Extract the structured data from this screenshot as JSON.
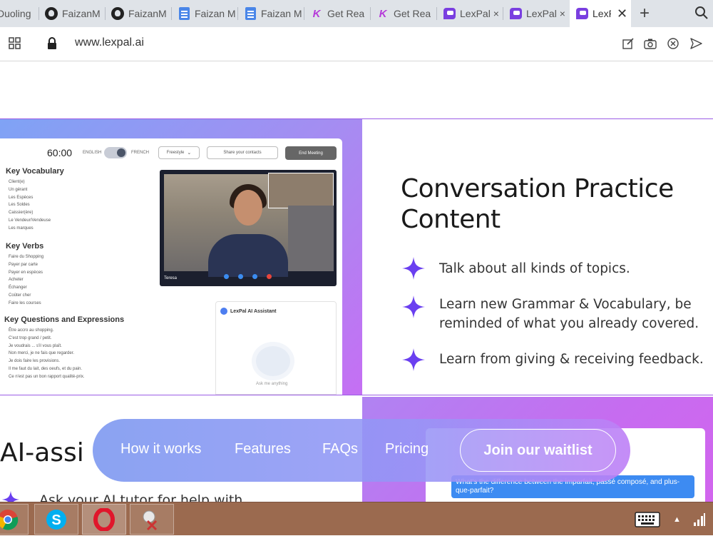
{
  "browser": {
    "tabs": [
      {
        "label": "Duoling",
        "icon": "duolingo-icon"
      },
      {
        "label": "FaizanM",
        "icon": "github-icon"
      },
      {
        "label": "FaizanM",
        "icon": "github-icon"
      },
      {
        "label": "Faizan M",
        "icon": "google-docs-icon"
      },
      {
        "label": "Faizan M",
        "icon": "google-docs-icon"
      },
      {
        "label": "Get Rea",
        "icon": "kotlin-icon"
      },
      {
        "label": "Get Rea",
        "icon": "kotlin-icon"
      },
      {
        "label": "LexPal ×",
        "icon": "lexpal-icon"
      },
      {
        "label": "LexPal ×",
        "icon": "lexpal-icon"
      },
      {
        "label": "LexP",
        "icon": "lexpal-icon",
        "active": true
      }
    ],
    "new_tab": "+",
    "url": "www.lexpal.ai"
  },
  "app_mock": {
    "timer": "60:00",
    "lang_left": "ENGLISH",
    "lang_right": "FRENCH",
    "mode_select": "Freestyle",
    "share_button": "Share your contacts",
    "end_button": "End Meeting",
    "vocab_heading": "Key Vocabulary",
    "vocab_items": [
      "Client(e)",
      "Un gérant",
      "Les Espèces",
      "Les Soldes",
      "Caissier(ère)",
      "Le Vendeur/Vendeuse",
      "Les marques"
    ],
    "verbs_heading": "Key Verbs",
    "verbs_items": [
      "Faire du Shopping",
      "Payer par carte",
      "Payer en espèces",
      "Acheter",
      "Échanger",
      "Coûter cher",
      "Faire les courses"
    ],
    "questions_heading": "Key Questions and Expressions",
    "questions_items": [
      "Être accro au shopping.",
      "C'est trop grand / petit.",
      "Je voudrais ... s'il vous plaît.",
      "Non merci, je ne fais que regarder.",
      "Je dois faire les provisions.",
      "Il me faut du lait, des oeufs, et du pain.",
      "Ce n'est pas un bon rapport qualité-prix."
    ],
    "video_name": "Teresa",
    "assistant_title": "LexPal AI Assistant",
    "assistant_hint": "Ask me anything"
  },
  "section": {
    "heading_line1": "Conversation Practice",
    "heading_line2": "Content",
    "features": [
      {
        "line1": "Talk about all kinds of topics.",
        "line2": ""
      },
      {
        "line1": "Learn new Grammar & Vocabulary, be",
        "line2": "reminded of what you already covered."
      },
      {
        "line1": "Learn from giving & receiving feedback.",
        "line2": ""
      }
    ],
    "accent_color": "#6a3ff0"
  },
  "lower": {
    "heading": "AI-assi",
    "text": "Ask your AI tutor for help with",
    "chat_question": "What's the difference between the imparfait, passé composé, and plus-que-parfait?"
  },
  "nav": {
    "how_it_works": "How it works",
    "features": "Features",
    "faqs": "FAQs",
    "pricing": "Pricing",
    "waitlist": "Join our waitlist"
  },
  "taskbar": {
    "apps": [
      "chrome-icon",
      "skype-icon",
      "opera-icon",
      "snipping-tool-icon"
    ]
  }
}
